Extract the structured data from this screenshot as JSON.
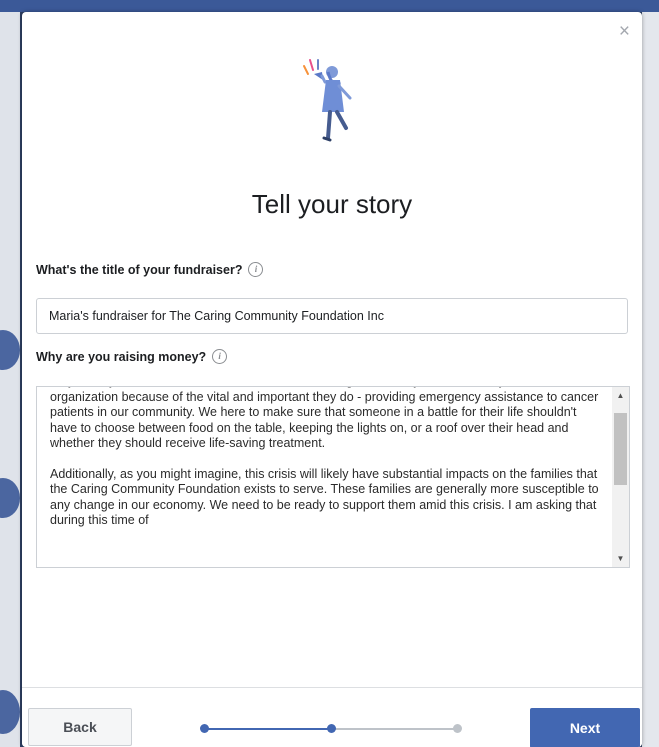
{
  "modal": {
    "close_glyph": "×",
    "title": "Tell your story",
    "fundraiser_title_label": "What's the title of your fundraiser?",
    "fundraiser_title_value": "Maria's fundraiser for The Caring Community Foundation Inc",
    "reason_label": "Why are you raising money?",
    "info_glyph": "i",
    "story_paragraphs": [
      "As you may know, I am a board member for the Caring Community Foundation. I joined this organization because of the vital and important they do - providing emergency assistance to cancer patients in our community. We here to make sure that someone in a battle for their life shouldn't have to choose between food on the table, keeping the lights on, or a roof over their head and whether they should receive life-saving treatment.",
      "Additionally, as you might imagine, this crisis will likely have substantial impacts on the families that the Caring Community Foundation exists to serve. These families are generally more susceptible to any change in our economy. We need to be ready to support them amid this crisis. I am asking that during this time of"
    ]
  },
  "footer": {
    "back_label": "Back",
    "next_label": "Next",
    "progress": {
      "total_steps": 3,
      "current_step": 2
    }
  },
  "colors": {
    "accent": "#4267b2",
    "progress_done": "#4267b2",
    "progress_todo": "#bec3c9"
  },
  "icons": {
    "close": "close-icon",
    "info": "info-icon",
    "illustration": "megaphone-person-illustration"
  }
}
